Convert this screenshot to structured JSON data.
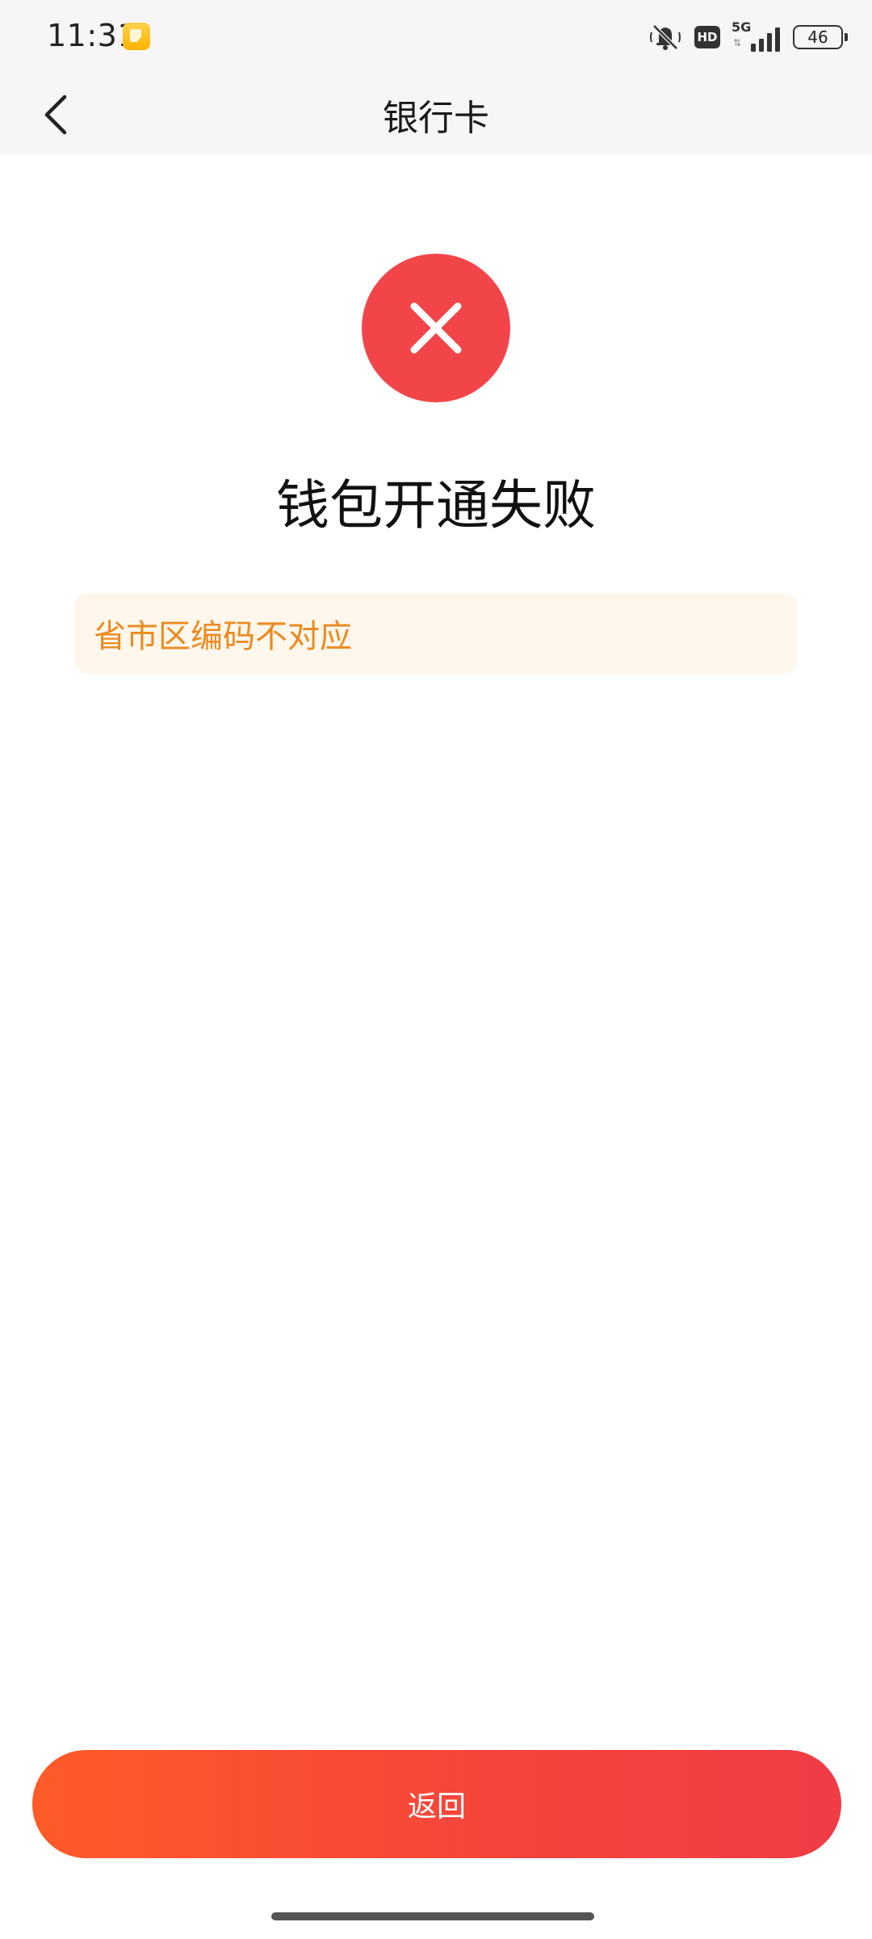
{
  "status_bar": {
    "time": "11:31",
    "network": "5G",
    "hd_badge": "HD",
    "battery": "46",
    "icons": [
      "notification-app-icon",
      "mute-icon",
      "hd-icon",
      "signal-icon",
      "battery-icon"
    ]
  },
  "header": {
    "title": "银行卡",
    "back_icon": "chevron-left-icon"
  },
  "result": {
    "icon": "close-icon",
    "icon_color": "#f2454a",
    "title": "钱包开通失败"
  },
  "notice": {
    "message": "省市区编码不对应",
    "text_color": "#ec8a1f",
    "background_color": "#fff7ec"
  },
  "footer": {
    "return_label": "返回",
    "button_gradient": [
      "#ff5a28",
      "#f03c46"
    ]
  }
}
